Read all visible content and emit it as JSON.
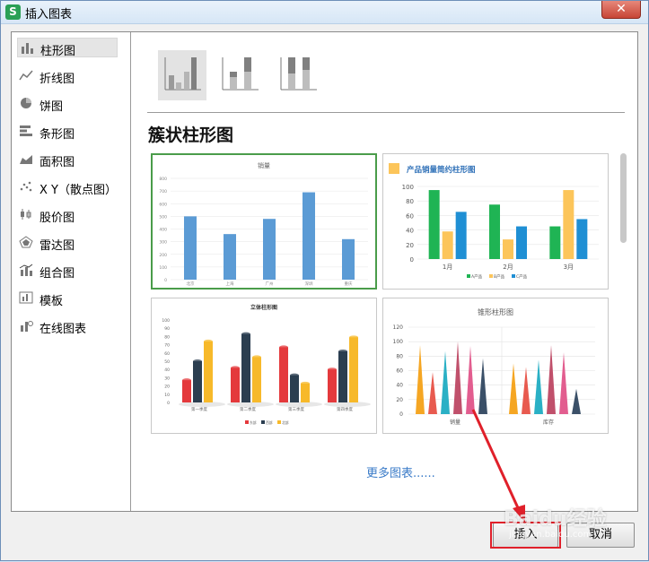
{
  "window": {
    "title": "插入图表",
    "app_icon_letter": "S",
    "close_glyph": "✕"
  },
  "sidebar": {
    "items": [
      {
        "label": "柱形图",
        "icon": "column-chart-icon"
      },
      {
        "label": "折线图",
        "icon": "line-chart-icon"
      },
      {
        "label": "饼图",
        "icon": "pie-chart-icon"
      },
      {
        "label": "条形图",
        "icon": "bar-chart-icon"
      },
      {
        "label": "面积图",
        "icon": "area-chart-icon"
      },
      {
        "label": "X Y（散点图）",
        "icon": "scatter-chart-icon"
      },
      {
        "label": "股价图",
        "icon": "stock-chart-icon"
      },
      {
        "label": "雷达图",
        "icon": "radar-chart-icon"
      },
      {
        "label": "组合图",
        "icon": "combo-chart-icon"
      },
      {
        "label": "模板",
        "icon": "template-icon"
      },
      {
        "label": "在线图表",
        "icon": "online-chart-icon"
      }
    ]
  },
  "main": {
    "section_title": "簇状柱形图",
    "more_link": "更多图表......",
    "thumbnails": {
      "t1": {
        "title": "销量",
        "yticks": [
          "800",
          "700",
          "600",
          "500",
          "400",
          "300",
          "200",
          "100",
          "0"
        ],
        "categories": [
          "北京",
          "上海",
          "广州",
          "深圳",
          "重庆"
        ]
      },
      "t2": {
        "title": "产品销量简约柱形图",
        "yticks": [
          "100",
          "80",
          "60",
          "40",
          "20",
          "0"
        ],
        "categories": [
          "1月",
          "2月",
          "3月"
        ],
        "legend": [
          "A产品",
          "B产品",
          "C产品"
        ]
      },
      "t3": {
        "title": "立体柱形图",
        "yticks": [
          "100",
          "90",
          "80",
          "70",
          "60",
          "50",
          "40",
          "30",
          "20",
          "10",
          "0"
        ],
        "categories": [
          "第一季度",
          "第二季度",
          "第三季度",
          "第四季度"
        ],
        "legend": [
          "东部",
          "西部",
          "北部"
        ]
      },
      "t4": {
        "title": "锥形柱形图",
        "yticks": [
          "120",
          "100",
          "80",
          "60",
          "40",
          "20",
          "0"
        ],
        "categories": [
          "销量",
          "库存"
        ]
      }
    }
  },
  "footer": {
    "insert_label": "插入",
    "cancel_label": "取消"
  },
  "watermark": {
    "text": "Baidu经验",
    "sub": "jingyan.baidu.com"
  },
  "chart_data": [
    {
      "type": "bar",
      "title": "销量",
      "categories": [
        "北京",
        "上海",
        "广州",
        "深圳",
        "重庆"
      ],
      "values": [
        500,
        360,
        480,
        690,
        320
      ],
      "ylim": [
        0,
        800
      ],
      "color": "#5b9bd5"
    },
    {
      "type": "bar",
      "title": "产品销量简约柱形图",
      "categories": [
        "1月",
        "2月",
        "3月"
      ],
      "series": [
        {
          "name": "A产品",
          "values": [
            95,
            75,
            45
          ],
          "color": "#1fb454"
        },
        {
          "name": "B产品",
          "values": [
            38,
            27,
            95
          ],
          "color": "#fcc55a"
        },
        {
          "name": "C产品",
          "values": [
            65,
            45,
            55
          ],
          "color": "#1f8fd4"
        }
      ],
      "ylim": [
        0,
        100
      ],
      "legend_position": "bottom"
    },
    {
      "type": "bar",
      "title": "立体柱形图",
      "categories": [
        "第一季度",
        "第二季度",
        "第三季度",
        "第四季度"
      ],
      "series": [
        {
          "name": "东部",
          "values": [
            27,
            42,
            67,
            40
          ],
          "color": "#e4393c"
        },
        {
          "name": "西部",
          "values": [
            50,
            83,
            33,
            62
          ],
          "color": "#2b3e50"
        },
        {
          "name": "北部",
          "values": [
            74,
            55,
            23,
            79
          ],
          "color": "#f7b92a"
        }
      ],
      "ylim": [
        0,
        100
      ],
      "legend_position": "bottom"
    },
    {
      "type": "bar",
      "title": "锥形柱形图",
      "categories": [
        "销量",
        "库存"
      ],
      "series_values": [
        [
          95,
          58,
          87,
          100,
          94,
          77
        ],
        [
          70,
          65,
          75,
          95,
          85,
          35
        ]
      ],
      "colors": [
        "#f5a623",
        "#e85a4f",
        "#2ab0c5",
        "#c0506b",
        "#e25d8f",
        "#3b5068"
      ],
      "ylim": [
        0,
        120
      ]
    }
  ],
  "colors": {
    "accent": "#4a9c4a",
    "link": "#3a7bc8",
    "highlight": "#e0202a"
  }
}
